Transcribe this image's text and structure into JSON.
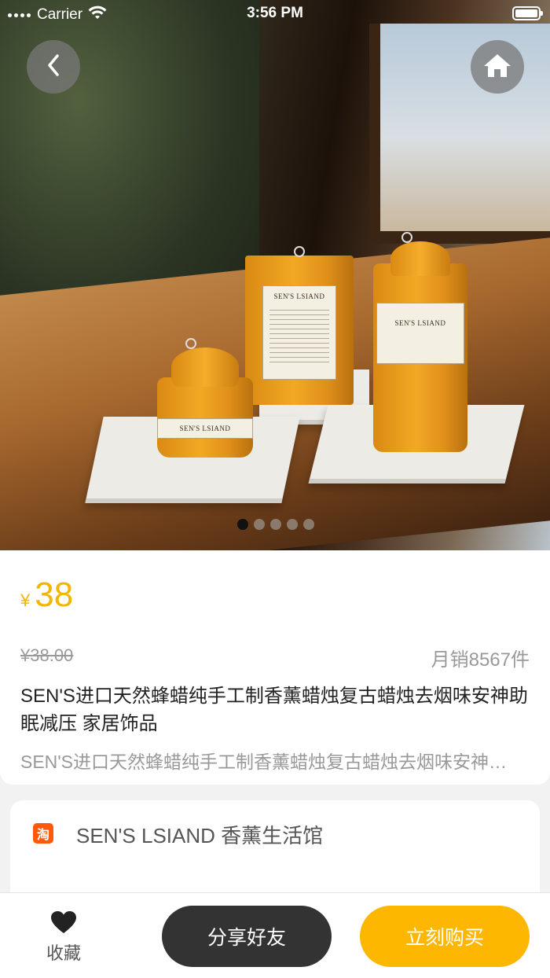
{
  "status_bar": {
    "carrier": "Carrier",
    "time": "3:56 PM"
  },
  "gallery": {
    "page_count": 5,
    "active_index": 0,
    "candle_brand_text": "SEN'S LSIAND"
  },
  "product": {
    "currency": "¥",
    "price": "38",
    "original_price": "¥38.00",
    "monthly_sales": "月销8567件",
    "title": "SEN'S进口天然蜂蜡纯手工制香薰蜡烛复古蜡烛去烟味安神助眠减压 家居饰品",
    "subtitle": "SEN'S进口天然蜂蜡纯手工制香薰蜡烛复古蜡烛去烟味安神助眠减压 家居饰品"
  },
  "shop": {
    "logo_char": "淘",
    "name": "SEN'S LSIAND 香薰生活馆"
  },
  "bottom_bar": {
    "favorite_label": "收藏",
    "share_label": "分享好友",
    "buy_label": "立刻购买"
  },
  "colors": {
    "accent": "#fdb700",
    "price": "#f5b400",
    "share_button": "#333333",
    "shop_logo": "#ff5a0a"
  }
}
